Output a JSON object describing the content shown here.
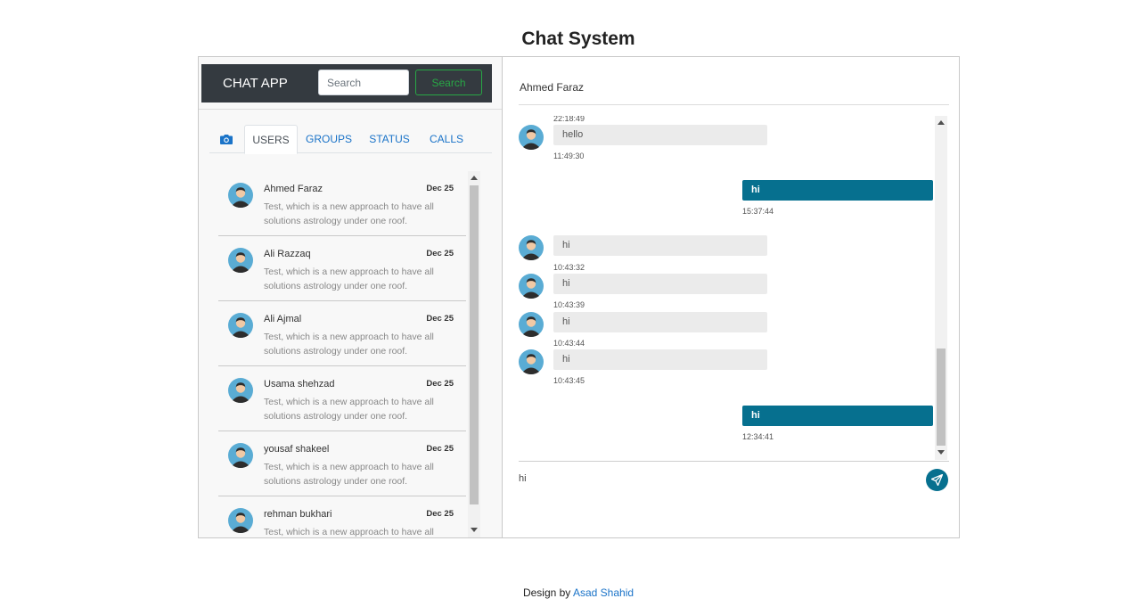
{
  "page": {
    "title": "Chat System"
  },
  "sidebar": {
    "brand": "CHAT APP",
    "search": {
      "placeholder": "Search",
      "button_label": "Search"
    },
    "tabs": [
      "USERS",
      "GROUPS",
      "STATUS",
      "CALLS"
    ],
    "active_tab": "USERS",
    "users": [
      {
        "name": "Ahmed Faraz",
        "date": "Dec 25",
        "preview": "Test, which is a new approach to have all solutions astrology under one roof."
      },
      {
        "name": "Ali Razzaq",
        "date": "Dec 25",
        "preview": "Test, which is a new approach to have all solutions astrology under one roof."
      },
      {
        "name": "Ali Ajmal",
        "date": "Dec 25",
        "preview": "Test, which is a new approach to have all solutions astrology under one roof."
      },
      {
        "name": "Usama shehzad",
        "date": "Dec 25",
        "preview": "Test, which is a new approach to have all solutions astrology under one roof."
      },
      {
        "name": "yousaf shakeel",
        "date": "Dec 25",
        "preview": "Test, which is a new approach to have all solutions astrology under one roof."
      },
      {
        "name": "rehman bukhari",
        "date": "Dec 25",
        "preview": "Test, which is a new approach to have all solutions astrology under one roof."
      }
    ]
  },
  "chat": {
    "contact_name": "Ahmed Faraz",
    "messages": [
      {
        "dir": "in",
        "text": "",
        "time": "22:18:49"
      },
      {
        "dir": "in",
        "text": "hello",
        "time": "11:49:30"
      },
      {
        "dir": "out",
        "text": "hi",
        "time": "15:37:44"
      },
      {
        "dir": "in",
        "text": "hi",
        "time": "10:43:32"
      },
      {
        "dir": "in",
        "text": "hi",
        "time": "10:43:39"
      },
      {
        "dir": "in",
        "text": "hi",
        "time": "10:43:44"
      },
      {
        "dir": "in",
        "text": "hi",
        "time": "10:43:45"
      },
      {
        "dir": "out",
        "text": "hi",
        "time": "12:34:41"
      }
    ],
    "input_value": "hi"
  },
  "footer": {
    "prefix": "Design by",
    "author": "Asad Shahid"
  },
  "colors": {
    "accent": "#06708f",
    "link": "#1a73c8",
    "appbar": "#343a40",
    "search_button": "#28a745"
  },
  "icons": {
    "tab_camera": "camera-icon",
    "send": "send-icon",
    "avatar": "avatar-icon"
  }
}
